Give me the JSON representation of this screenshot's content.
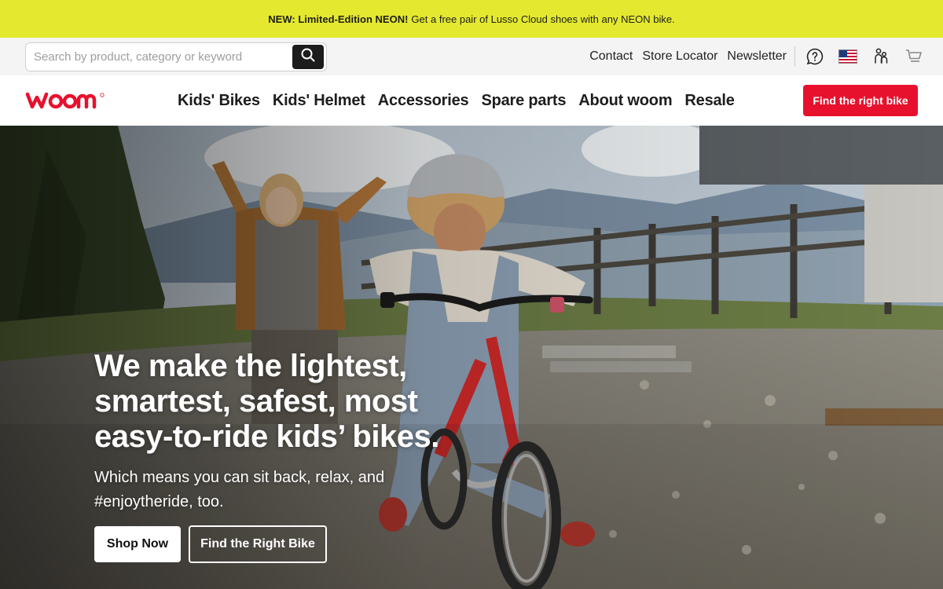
{
  "announcement": {
    "bold": "NEW: Limited-Edition NEON!",
    "text": "Get a free pair of Lusso Cloud shoes with any NEON bike."
  },
  "search": {
    "placeholder": "Search by product, category or keyword",
    "icon": "search-icon"
  },
  "util_links": [
    "Contact",
    "Store Locator",
    "Newsletter"
  ],
  "util_icons": [
    "help-icon",
    "us-flag-icon",
    "community-icon",
    "cart-icon"
  ],
  "brand": {
    "name": "woom",
    "color": "#e8112d"
  },
  "nav": [
    "Kids' Bikes",
    "Kids' Helmet",
    "Accessories",
    "Spare parts",
    "About woom",
    "Resale"
  ],
  "nav_cta": "Find the right bike",
  "hero": {
    "title": "We make the lightest, smartest, safest, most easy-to-ride kids’ bikes.",
    "subtitle": "Which means you can sit back, relax, and #enjoytheride, too.",
    "primary_button": "Shop Now",
    "secondary_button": "Find the Right Bike"
  },
  "colors": {
    "announcement_bg": "#e4e92f",
    "accent_red": "#e8112d",
    "util_bg": "#f4f4f4"
  }
}
